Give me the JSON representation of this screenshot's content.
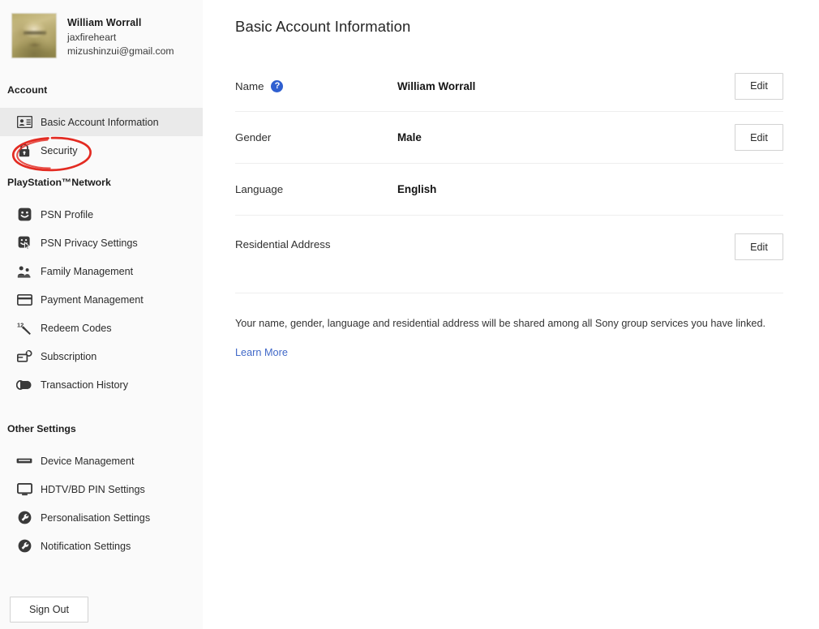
{
  "sidebar": {
    "profile": {
      "avatar_name": "user-avatar",
      "display_name": "William Worrall",
      "online_id": "jaxfireheart",
      "email": "mizushinzui@gmail.com"
    },
    "sections": [
      {
        "heading": "Account",
        "items": [
          {
            "label": "Basic Account Information",
            "icon": "id-card-icon",
            "selected": true
          },
          {
            "label": "Security",
            "icon": "lock-icon",
            "selected": false,
            "annotated": true
          }
        ]
      },
      {
        "heading": "PlayStation™Network",
        "items": [
          {
            "label": "PSN Profile",
            "icon": "smiley-face-icon",
            "selected": false
          },
          {
            "label": "PSN Privacy Settings",
            "icon": "privacy-cursor-icon",
            "selected": false
          },
          {
            "label": "Family Management",
            "icon": "family-people-icon",
            "selected": false
          },
          {
            "label": "Payment Management",
            "icon": "credit-card-icon",
            "selected": false
          },
          {
            "label": "Redeem Codes",
            "icon": "scratch-code-icon",
            "selected": false
          },
          {
            "label": "Subscription",
            "icon": "subscription-renew-icon",
            "selected": false
          },
          {
            "label": "Transaction History",
            "icon": "transaction-coins-icon",
            "selected": false
          }
        ]
      },
      {
        "heading": "Other Settings",
        "items": [
          {
            "label": "Device Management",
            "icon": "console-device-icon",
            "selected": false
          },
          {
            "label": "HDTV/BD PIN Settings",
            "icon": "monitor-tv-icon",
            "selected": false
          },
          {
            "label": "Personalisation Settings",
            "icon": "wrench-circle-icon",
            "selected": false
          },
          {
            "label": "Notification Settings",
            "icon": "wrench-circle-icon",
            "selected": false
          }
        ]
      }
    ],
    "sign_out_label": "Sign Out"
  },
  "annotation": {
    "type": "hand-drawn-ellipse",
    "target": "Security",
    "color": "#e32b22"
  },
  "main": {
    "title": "Basic Account Information",
    "rows": [
      {
        "label": "Name",
        "value": "William Worrall",
        "has_help": true,
        "help_glyph": "?",
        "edit_label": "Edit",
        "has_edit": true
      },
      {
        "label": "Gender",
        "value": "Male",
        "has_help": false,
        "edit_label": "Edit",
        "has_edit": true
      },
      {
        "label": "Language",
        "value": "English",
        "has_help": false,
        "edit_label": "",
        "has_edit": false
      },
      {
        "label": "Residential Address",
        "value": "",
        "has_help": false,
        "edit_label": "Edit",
        "has_edit": true
      }
    ],
    "footnote": "Your name, gender, language and residential address will be shared among all Sony group services you have linked.",
    "learn_more_label": "Learn More"
  },
  "colors": {
    "sidebar_bg": "#fafafa",
    "selected_bg": "#eaeaea",
    "help_blue": "#2f5fd0",
    "link_blue": "#4169c8",
    "annotation_red": "#e32b22",
    "divider": "#eeeeee"
  }
}
